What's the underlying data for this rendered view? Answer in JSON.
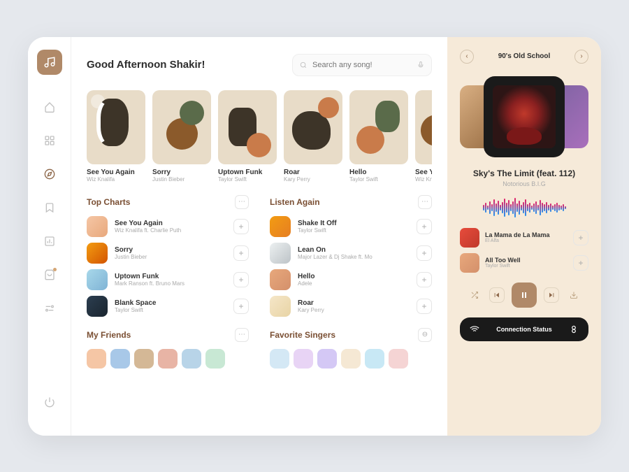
{
  "greeting": "Good Afternoon Shakir!",
  "search": {
    "placeholder": "Search any song!"
  },
  "carousel": [
    {
      "title": "See You Again",
      "artist": "Wiz Knalifa"
    },
    {
      "title": "Sorry",
      "artist": "Justin Bieber"
    },
    {
      "title": "Uptown Funk",
      "artist": "Taylor Swift"
    },
    {
      "title": "Roar",
      "artist": "Kary Perry"
    },
    {
      "title": "Hello",
      "artist": "Taylor Swift"
    },
    {
      "title": "See You",
      "artist": "Wiz Knali"
    }
  ],
  "sections": {
    "topCharts": {
      "title": "Top Charts"
    },
    "listenAgain": {
      "title": "Listen Again"
    },
    "myFriends": {
      "title": "My Friends"
    },
    "favoriteSingers": {
      "title": "Favorite Singers"
    }
  },
  "topCharts": [
    {
      "title": "See You Again",
      "artist": "Wiz Knalifa ft. Charlie Puth"
    },
    {
      "title": "Sorry",
      "artist": "Justin Bieber"
    },
    {
      "title": "Uptown Funk",
      "artist": "Mark Ranson ft. Bruno Mars"
    },
    {
      "title": "Blank Space",
      "artist": "Taylor Swift"
    }
  ],
  "listenAgain": [
    {
      "title": "Shake It Off",
      "artist": "Taylor Swift"
    },
    {
      "title": "Lean On",
      "artist": "Major Lazer & Dj Shake ft. Mo"
    },
    {
      "title": "Hello",
      "artist": "Adele"
    },
    {
      "title": "Roar",
      "artist": "Kary Perry"
    }
  ],
  "player": {
    "playlist": "90's Old School",
    "nowPlaying": {
      "title": "Sky's The Limit (feat. 112)",
      "artist": "Notorious B.I.G"
    },
    "queue": [
      {
        "title": "La Mama de La Mama",
        "artist": "El Alfa"
      },
      {
        "title": "All Too Well",
        "artist": "Taylor Swift"
      }
    ],
    "connection": "Connection Status"
  }
}
